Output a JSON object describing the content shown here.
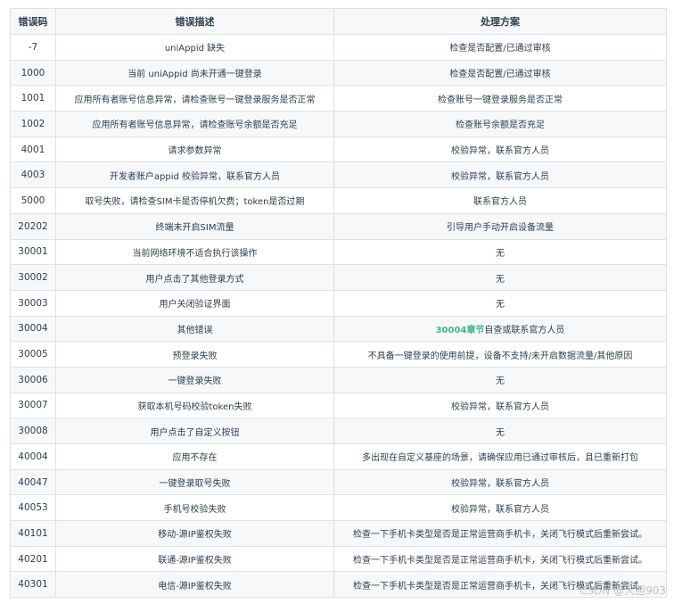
{
  "headers": {
    "code": "错误码",
    "desc": "错误描述",
    "solution": "处理方案"
  },
  "rows": [
    {
      "code": "-7",
      "desc": "uniAppid 缺失",
      "solution": "检查是否配置/已通过审核"
    },
    {
      "code": "1000",
      "desc": "当前 uniAppid 尚未开通一键登录",
      "solution": "检查是否配置/已通过审核"
    },
    {
      "code": "1001",
      "desc": "应用所有者账号信息异常，请检查账号一键登录服务是否正常",
      "solution": "检查账号一键登录服务是否正常"
    },
    {
      "code": "1002",
      "desc": "应用所有者账号信息异常，请检查账号余额是否充足",
      "solution": "检查账号余额是否充足"
    },
    {
      "code": "4001",
      "desc": "请求参数异常",
      "solution": "校验异常，联系官方人员"
    },
    {
      "code": "4003",
      "desc": "开发者账户appid 校验异常，联系官方人员",
      "solution": "校验异常，联系官方人员"
    },
    {
      "code": "5000",
      "desc": "取号失败，请检查SIM卡是否停机欠费；token是否过期",
      "solution": "联系官方人员"
    },
    {
      "code": "20202",
      "desc": "终端未开启SIM流量",
      "solution": "引导用户手动开启设备流量"
    },
    {
      "code": "30001",
      "desc": "当前网络环境不适合执行该操作",
      "solution": "无"
    },
    {
      "code": "30002",
      "desc": "用户点击了其他登录方式",
      "solution": "无"
    },
    {
      "code": "30003",
      "desc": "用户关闭验证界面",
      "solution": "无"
    },
    {
      "code": "30004",
      "desc": "其他错误",
      "solution_link": "30004章节",
      "solution": "自查或联系官方人员"
    },
    {
      "code": "30005",
      "desc": "预登录失败",
      "solution": "不具备一键登录的使用前提，设备不支持/未开启数据流量/其他原因"
    },
    {
      "code": "30006",
      "desc": "一键登录失败",
      "solution": "无"
    },
    {
      "code": "30007",
      "desc": "获取本机号码校验token失败",
      "solution": "校验异常，联系官方人员"
    },
    {
      "code": "30008",
      "desc": "用户点击了自定义按钮",
      "solution": "无"
    },
    {
      "code": "40004",
      "desc": "应用不存在",
      "solution": "多出现在自定义基座的场景，请确保应用已通过审核后，且已重新打包"
    },
    {
      "code": "40047",
      "desc": "一键登录取号失败",
      "solution": "校验异常，联系官方人员"
    },
    {
      "code": "40053",
      "desc": "手机号校验失败",
      "solution": "校验异常，联系官方人员"
    },
    {
      "code": "40101",
      "desc": "移动-源IP鉴权失败",
      "solution": "检查一下手机卡类型是否是正常运营商手机卡，关闭飞行模式后重新尝试。"
    },
    {
      "code": "40201",
      "desc": "联通-源IP鉴权失败",
      "solution": "检查一下手机卡类型是否是正常运营商手机卡，关闭飞行模式后重新尝试。"
    },
    {
      "code": "40301",
      "desc": "电信-源IP鉴权失败",
      "solution": "检查一下手机卡类型是否是正常运营商手机卡，关闭飞行模式后重新尝试。"
    }
  ],
  "watermark": "CSDN @大胆903",
  "colors": {
    "link": "#42b983",
    "header_bg": "#f6f8fa",
    "border": "#dfe2e5",
    "text": "#2c3e50"
  }
}
